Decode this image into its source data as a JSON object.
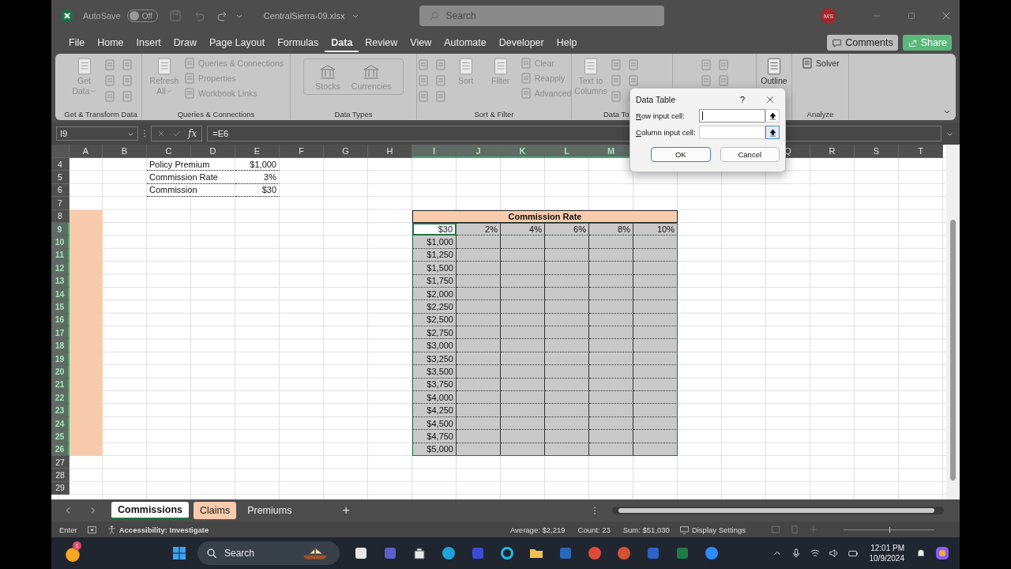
{
  "title_bar": {
    "autosave_label": "AutoSave",
    "autosave_state": "Off",
    "autosave_on": false,
    "file_name": "CentralSierra-09.xlsx",
    "search_placeholder": "Search",
    "avatar": "MS"
  },
  "menu_tabs": [
    {
      "label": "File",
      "selected": false
    },
    {
      "label": "Home",
      "selected": false
    },
    {
      "label": "Insert",
      "selected": false
    },
    {
      "label": "Draw",
      "selected": false
    },
    {
      "label": "Page Layout",
      "selected": false
    },
    {
      "label": "Formulas",
      "selected": false
    },
    {
      "label": "Data",
      "selected": true
    },
    {
      "label": "Review",
      "selected": false
    },
    {
      "label": "View",
      "selected": false
    },
    {
      "label": "Automate",
      "selected": false
    },
    {
      "label": "Developer",
      "selected": false
    },
    {
      "label": "Help",
      "selected": false
    }
  ],
  "header_buttons": [
    {
      "kind": "comments",
      "label": "Comments"
    },
    {
      "kind": "share",
      "label": "Share"
    }
  ],
  "ribbon_groups": [
    {
      "label": "Get & Transform Data",
      "items": [
        {
          "kind": "large",
          "label": "Get Data",
          "caret": true,
          "disabled": true
        },
        {
          "kind": "icon_grid",
          "disabled": true
        }
      ]
    },
    {
      "label": "Queries & Connections",
      "items": [
        {
          "kind": "large",
          "label": "Refresh All",
          "caret": true,
          "disabled": true
        },
        {
          "kind": "small_list",
          "disabled": true,
          "entries": [
            "Queries & Connections",
            "Properties",
            "Workbook Links"
          ]
        }
      ]
    },
    {
      "label": "Data Types",
      "items": [
        {
          "kind": "gallery",
          "disabled": true,
          "entries": [
            "Stocks",
            "Currencies"
          ]
        }
      ]
    },
    {
      "label": "Sort & Filter",
      "items": [
        {
          "kind": "icon_grid",
          "disabled": true
        },
        {
          "kind": "large",
          "label": "Sort",
          "disabled": true
        },
        {
          "kind": "large",
          "label": "Filter",
          "disabled": true
        },
        {
          "kind": "small_list",
          "disabled": true,
          "entries": [
            "Clear",
            "Reapply",
            "Advanced"
          ]
        }
      ]
    },
    {
      "label": "Data To",
      "items": [
        {
          "kind": "large",
          "label": "Text to Columns",
          "disabled": true
        },
        {
          "kind": "icon_grid",
          "disabled": true
        }
      ]
    },
    {
      "items": [
        {
          "kind": "icon_grid",
          "disabled": true
        }
      ]
    },
    {
      "items": [
        {
          "kind": "large",
          "label": "Outline",
          "disabled": false
        }
      ]
    },
    {
      "label": "Analyze",
      "items": [
        {
          "kind": "small_list",
          "disabled": false,
          "entries": [
            "Solver"
          ]
        }
      ]
    }
  ],
  "formula_bar": {
    "name_box": "I9",
    "fx": "fx",
    "formula": "=E6"
  },
  "sheet": {
    "columns": [
      {
        "label": "A",
        "selected": false
      },
      {
        "label": "B",
        "selected": false
      },
      {
        "label": "C",
        "selected": false
      },
      {
        "label": "D",
        "selected": false
      },
      {
        "label": "E",
        "selected": false
      },
      {
        "label": "F",
        "selected": false
      },
      {
        "label": "G",
        "selected": false
      },
      {
        "label": "H",
        "selected": false
      },
      {
        "label": "I",
        "selected": true
      },
      {
        "label": "J",
        "selected": true
      },
      {
        "label": "K",
        "selected": true
      },
      {
        "label": "L",
        "selected": true
      },
      {
        "label": "M",
        "selected": true
      },
      null,
      null,
      null,
      {
        "label": "Q",
        "selected": false
      },
      {
        "label": "R",
        "selected": false
      },
      {
        "label": "S",
        "selected": false
      },
      {
        "label": "T",
        "selected": false
      }
    ],
    "row_numbers": [
      {
        "label": "4",
        "selected": false
      },
      {
        "label": "5",
        "selected": false
      },
      {
        "label": "6",
        "selected": false
      },
      {
        "label": "7",
        "selected": false
      },
      {
        "label": "8",
        "selected": false
      },
      {
        "label": "9",
        "selected": true
      },
      {
        "label": "10",
        "selected": true
      },
      {
        "label": "11",
        "selected": true
      },
      {
        "label": "12",
        "selected": true
      },
      {
        "label": "13",
        "selected": true
      },
      {
        "label": "14",
        "selected": true
      },
      {
        "label": "15",
        "selected": true
      },
      {
        "label": "16",
        "selected": true
      },
      {
        "label": "17",
        "selected": true
      },
      {
        "label": "18",
        "selected": true
      },
      {
        "label": "19",
        "selected": true
      },
      {
        "label": "20",
        "selected": true
      },
      {
        "label": "21",
        "selected": true
      },
      {
        "label": "22",
        "selected": true
      },
      {
        "label": "23",
        "selected": true
      },
      {
        "label": "24",
        "selected": true
      },
      {
        "label": "25",
        "selected": true
      },
      {
        "label": "26",
        "selected": true
      },
      {
        "label": "27",
        "selected": false
      },
      {
        "label": "28",
        "selected": false
      },
      {
        "label": "29",
        "selected": false
      }
    ],
    "inputs": [
      {
        "label": "Policy Premium",
        "value": "$1,000"
      },
      {
        "label": "Commission Rate",
        "value": "3%"
      },
      {
        "label": "Commission",
        "value": "$30"
      }
    ],
    "data_table": {
      "title": "Commission Rate",
      "corner": "$30",
      "selected": true,
      "label_column_fill": true,
      "rates": [
        "2%",
        "4%",
        "6%",
        "8%",
        "10%"
      ],
      "premiums": [
        "$1,000",
        "$1,250",
        "$1,500",
        "$1,750",
        "$2,000",
        "$2,250",
        "$2,500",
        "$2,750",
        "$3,000",
        "$3,250",
        "$3,500",
        "$3,750",
        "$4,000",
        "$4,250",
        "$4,500",
        "$4,750",
        "$5,000"
      ]
    }
  },
  "dialog": {
    "title": "Data Table",
    "help": "?",
    "fields": [
      {
        "label": "Row input cell:",
        "focused": true
      },
      {
        "label": "Column input cell:",
        "focused": false
      }
    ],
    "buttons": [
      {
        "label": "OK",
        "default": true
      },
      {
        "label": "Cancel",
        "default": false
      }
    ]
  },
  "sheet_tabs": [
    {
      "label": "Commissions",
      "selected": true
    },
    {
      "label": "Claims",
      "selected": false,
      "color": "#f8cbad"
    },
    {
      "label": "Premiums",
      "selected": false
    }
  ],
  "add_sheet": "+",
  "status_bar": {
    "mode": "Enter",
    "accessibility": "Accessibility: Investigate",
    "stats": [
      "Average: $2,219",
      "Count: 23",
      "Sum: $51,030"
    ],
    "display_settings": "Display Settings",
    "zoom": {
      "level": 0.5
    }
  },
  "taskbar": {
    "notification_count": "1",
    "search_placeholder": "Search",
    "time": "12:01 PM",
    "date": "10/9/2024"
  }
}
